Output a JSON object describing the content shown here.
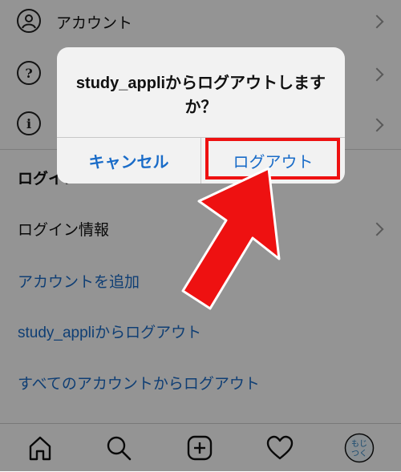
{
  "settings": {
    "rows": [
      {
        "label": "アカウント",
        "icon": "person-icon"
      },
      {
        "label": "",
        "icon": "help-icon"
      },
      {
        "label": "",
        "icon": "info-icon"
      }
    ],
    "section_title": "ログイン",
    "login_info_label": "ログイン情報",
    "add_account_label": "アカウントを追加",
    "logout_user_label": "study_appliからログアウト",
    "logout_all_label": "すべてのアカウントからログアウト"
  },
  "alert": {
    "title": "study_appliからログアウトしますか？",
    "cancel_label": "キャンセル",
    "logout_label": "ログアウト"
  },
  "tabbar": {
    "items": [
      "home-icon",
      "search-icon",
      "new-post-icon",
      "heart-icon",
      "profile-avatar"
    ],
    "avatar_text": "もじ\nつく"
  },
  "colors": {
    "link_blue": "#1a6cc8",
    "highlight_red": "#ee1111",
    "overlay": "rgba(0,0,0,0.42)"
  }
}
